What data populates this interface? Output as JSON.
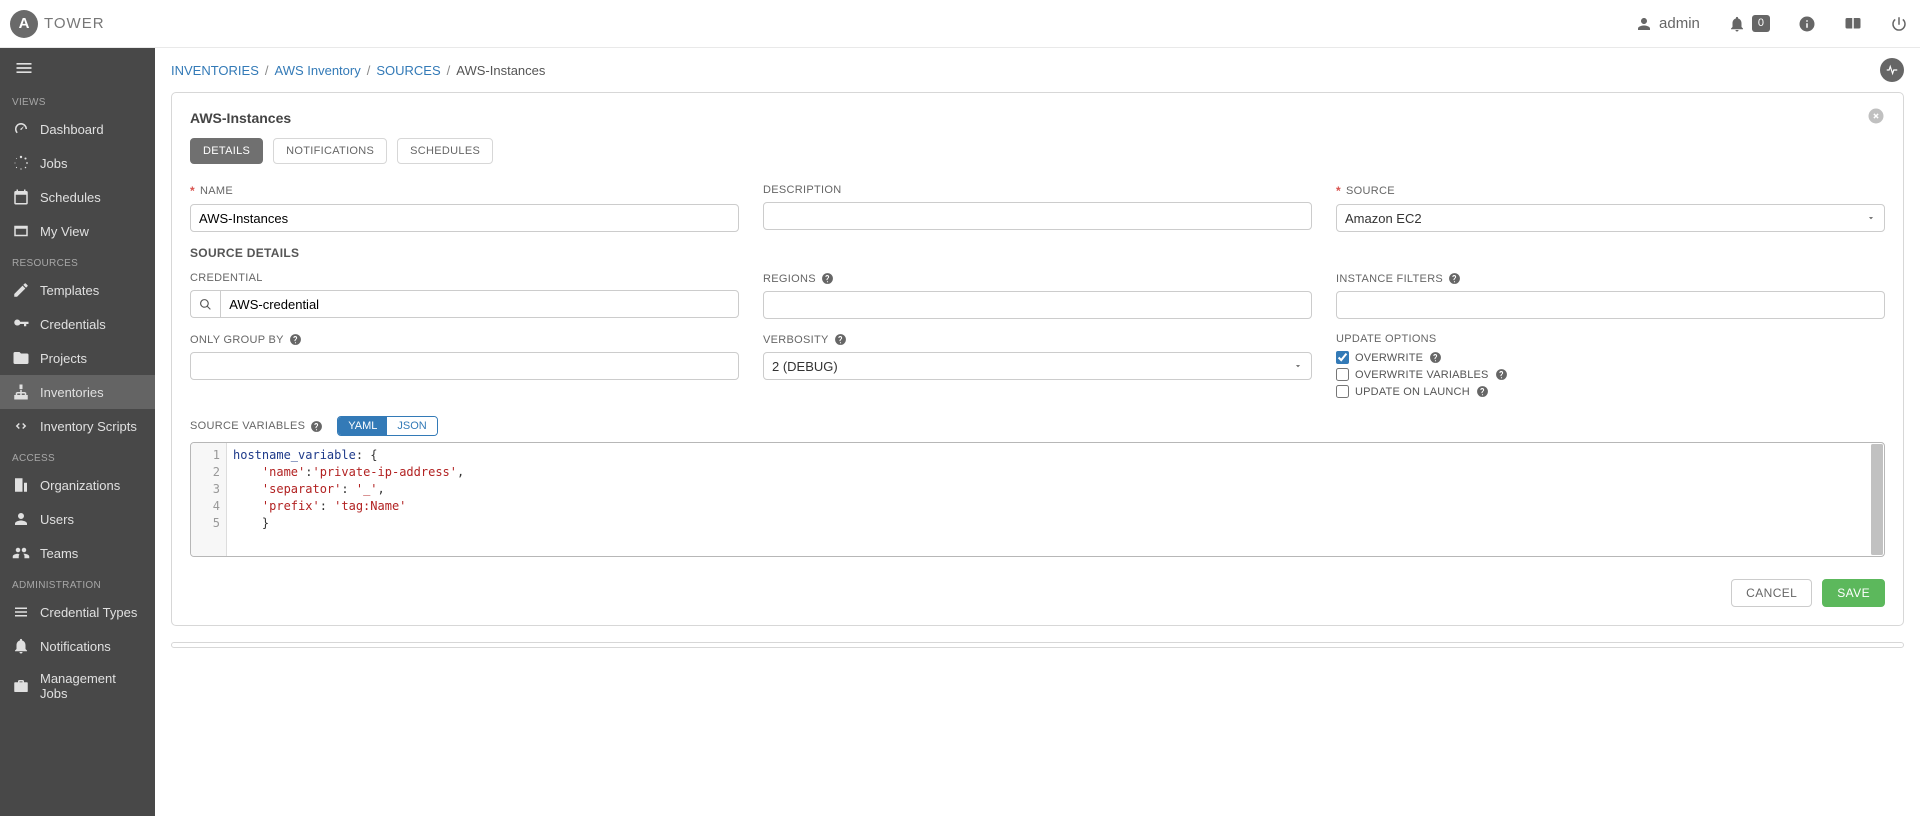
{
  "brand": {
    "logo_letter": "A",
    "name": "TOWER"
  },
  "topbar": {
    "user": "admin",
    "alerts_count": "0"
  },
  "sidebar": {
    "sections": {
      "views": {
        "label": "VIEWS",
        "items": [
          {
            "key": "dashboard",
            "label": "Dashboard"
          },
          {
            "key": "jobs",
            "label": "Jobs"
          },
          {
            "key": "schedules",
            "label": "Schedules"
          },
          {
            "key": "myview",
            "label": "My View"
          }
        ]
      },
      "resources": {
        "label": "RESOURCES",
        "items": [
          {
            "key": "templates",
            "label": "Templates"
          },
          {
            "key": "credentials",
            "label": "Credentials"
          },
          {
            "key": "projects",
            "label": "Projects"
          },
          {
            "key": "inventories",
            "label": "Inventories"
          },
          {
            "key": "invscripts",
            "label": "Inventory Scripts"
          }
        ]
      },
      "access": {
        "label": "ACCESS",
        "items": [
          {
            "key": "orgs",
            "label": "Organizations"
          },
          {
            "key": "users",
            "label": "Users"
          },
          {
            "key": "teams",
            "label": "Teams"
          }
        ]
      },
      "admin": {
        "label": "ADMINISTRATION",
        "items": [
          {
            "key": "credtypes",
            "label": "Credential Types"
          },
          {
            "key": "notifications_admin",
            "label": "Notifications"
          },
          {
            "key": "mgmtjobs",
            "label": "Management Jobs"
          }
        ]
      }
    }
  },
  "breadcrumb": {
    "l1": "INVENTORIES",
    "l2": "AWS Inventory",
    "l3": "SOURCES",
    "l4": "AWS-Instances"
  },
  "panel": {
    "title": "AWS-Instances",
    "tabs": {
      "details": "DETAILS",
      "notifications": "NOTIFICATIONS",
      "schedules": "SCHEDULES"
    },
    "fields": {
      "name_label": "NAME",
      "name_value": "AWS-Instances",
      "description_label": "DESCRIPTION",
      "description_value": "",
      "source_label": "SOURCE",
      "source_value": "Amazon EC2",
      "section_source_details": "SOURCE DETAILS",
      "credential_label": "CREDENTIAL",
      "credential_value": "AWS-credential",
      "regions_label": "REGIONS",
      "regions_value": "",
      "instance_filters_label": "INSTANCE FILTERS",
      "instance_filters_value": "",
      "only_group_by_label": "ONLY GROUP BY",
      "only_group_by_value": "",
      "verbosity_label": "VERBOSITY",
      "verbosity_value": "2 (DEBUG)",
      "update_options_label": "UPDATE OPTIONS",
      "opt_overwrite": "OVERWRITE",
      "opt_overwrite_vars": "OVERWRITE VARIABLES",
      "opt_update_on_launch": "UPDATE ON LAUNCH",
      "source_variables_label": "SOURCE VARIABLES",
      "toggle_yaml": "YAML",
      "toggle_json": "JSON"
    },
    "source_variables": {
      "line_numbers": [
        "1",
        "2",
        "3",
        "4",
        "5"
      ],
      "raw": "hostname_variable: {\n    'name':'private-ip-address',\n    'separator': '_',\n    'prefix': 'tag:Name'\n    }"
    },
    "actions": {
      "cancel": "CANCEL",
      "save": "SAVE"
    }
  }
}
